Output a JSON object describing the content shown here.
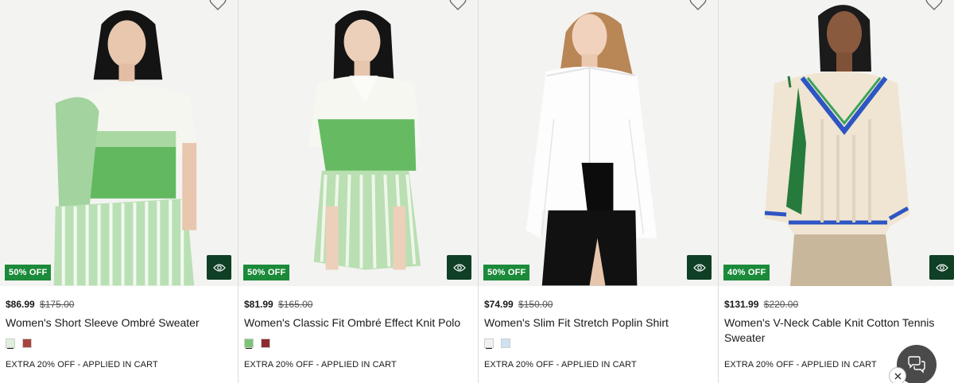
{
  "colors": {
    "badge": "#1b8a3a",
    "quick_view": "#0f3f24",
    "chat": "#4a4a4a"
  },
  "icons": {
    "wishlist": "heart-outline",
    "quick_view": "eye-icon",
    "chat": "chat-bubbles",
    "close": "x-mark"
  },
  "products": [
    {
      "badge": "50% OFF",
      "sale_price": "$86.99",
      "original_price": "$175.00",
      "name": "Women's Short Sleeve Ombré Sweater",
      "swatches": [
        "#dfeedd",
        "#a8453f"
      ],
      "promo": "EXTRA 20% OFF - APPLIED IN CART"
    },
    {
      "badge": "50% OFF",
      "sale_price": "$81.99",
      "original_price": "$165.00",
      "name": "Women's Classic Fit Ombré Effect Knit Polo",
      "swatches": [
        "#7cc47a",
        "#8e2b2f"
      ],
      "promo": "EXTRA 20% OFF - APPLIED IN CART"
    },
    {
      "badge": "50% OFF",
      "sale_price": "$74.99",
      "original_price": "$150.00",
      "name": "Women's Slim Fit Stretch Poplin Shirt",
      "swatches": [
        "#f1f1f1",
        "#cfe2f1"
      ],
      "promo": "EXTRA 20% OFF - APPLIED IN CART"
    },
    {
      "badge": "40% OFF",
      "sale_price": "$131.99",
      "original_price": "$220.00",
      "name": "Women's V-Neck Cable Knit Cotton Tennis Sweater",
      "swatches": [],
      "promo": "EXTRA 20% OFF - APPLIED IN CART"
    }
  ]
}
